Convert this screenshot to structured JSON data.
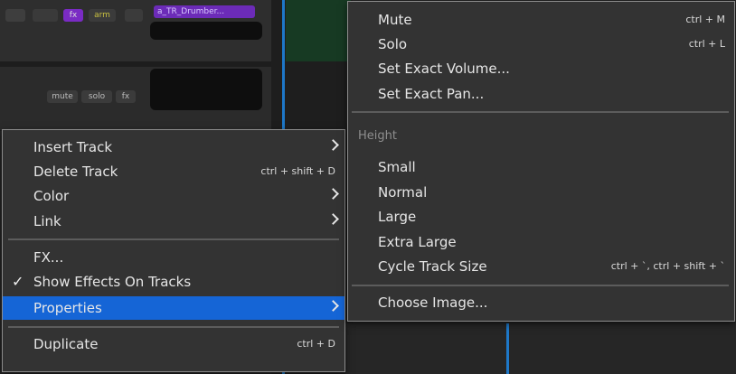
{
  "background": {
    "clip_name": "a_TR_Drumber...",
    "controls_row1": [
      "fx",
      "arm"
    ],
    "controls_row2": [
      "mute",
      "solo",
      "fx"
    ]
  },
  "context_menu": {
    "items": [
      {
        "label": "Insert Track",
        "has_submenu": true
      },
      {
        "label": "Delete Track",
        "shortcut": "ctrl + shift + D"
      },
      {
        "label": "Color",
        "has_submenu": true
      },
      {
        "label": "Link",
        "has_submenu": true
      },
      {
        "label": "FX..."
      },
      {
        "label": "Show Effects On Tracks",
        "checked": true,
        "check_glyph": "✓"
      },
      {
        "label": "Properties",
        "has_submenu": true,
        "active": true
      },
      {
        "label": "Duplicate",
        "shortcut": "ctrl + D"
      }
    ]
  },
  "submenu": {
    "items": [
      {
        "label": "Mute",
        "shortcut": "ctrl + M"
      },
      {
        "label": "Solo",
        "shortcut": "ctrl + L"
      },
      {
        "label": "Set Exact Volume..."
      },
      {
        "label": "Set Exact Pan..."
      }
    ],
    "height_header": "Height",
    "height_items": [
      {
        "label": "Small"
      },
      {
        "label": "Normal"
      },
      {
        "label": "Large"
      },
      {
        "label": "Extra Large"
      },
      {
        "label": "Cycle Track Size",
        "shortcut": "ctrl + `, ctrl + shift + `"
      }
    ],
    "image_item": {
      "label": "Choose Image..."
    }
  },
  "colors": {
    "menu_bg": "#333333",
    "highlight": "#1565d6",
    "text": "#e6e6e6",
    "accent_purple": "#8a3fd1"
  }
}
